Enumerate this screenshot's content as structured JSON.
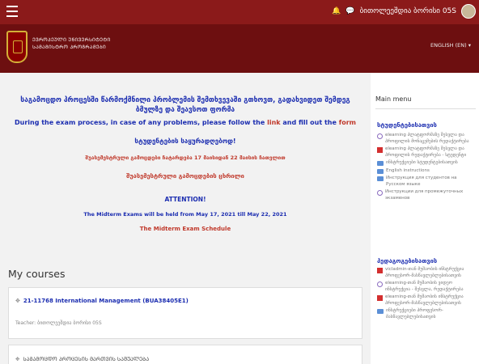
{
  "topbar": {
    "user_name": "ბითოლეეშდია ბორისი 05S",
    "bell_icon": "bell-icon",
    "chat_icon": "message-icon"
  },
  "header": {
    "university_line1": "ᲔᲕᲠᲝᲞᲔᲣᲚᲘ ᲣᲜᲘᲕᲔᲠᲡᲘᲢᲔᲢᲘ",
    "university_line2": "ᲡᲐᲛᲐᲒᲘᲡᲢᲠᲝ ᲞᲠᲝᲒᲠᲐᲛᲔᲑᲘ",
    "language": "ENGLISH (EN) ▾"
  },
  "announcement": {
    "georgian_intro": "საგამოცდო პროცესში წარმოქმნილი პრობლემის შემთხვევაში გთხოვთ, გადახვიდეთ შემდეგ ბმულზე და შეავსოთ ფორმა",
    "english_intro_prefix": "During the exam process, in case of any problems, please follow the",
    "link_text": "link",
    "english_intro_mid": "and fill out the",
    "form_text": "form",
    "students_attention": "სტუდენტების საყურადღებოდ!",
    "midterm_georgian": "შუასემესტრული გამოცდები ჩატარდება 17 მაისიდან 22 მაისის ჩათვლით",
    "midterm_schedule_georgian": "შუასემესტრული გამოცდების ცხრილი",
    "attention": "ATTENTION!",
    "midterm_english_prefix": "The Midterm Exams will be held from May 17, 2021 till",
    "midterm_english_date": "May 22, 2021",
    "midterm_schedule_english": "The Midterm Exam Schedule"
  },
  "courses": {
    "heading": "My courses",
    "items": [
      {
        "title": "21-11768 International Management (BUA38405E1)",
        "teacher": "Teacher: ბითოლეეშდია ბორისი 05S"
      },
      {
        "title": "ᲡᲐᲒᲐᲛᲝᲪᲓᲝ ᲞᲠᲝᲪᲔᲡᲘᲡ ᲛᲐᲠᲗᲕᲘᲡ ᲡᲐᲨᲣᲐᲚᲔᲑᲐ",
        "teacher": ""
      }
    ]
  },
  "sidebar": {
    "main_menu": "Main menu",
    "students_heading": "სტუდენტებისათვის",
    "students_items": [
      {
        "icon": "quiz",
        "text": "elearning პლატფორმაზე შესვლა და პროფილის მონაცემების რედაქტირება"
      },
      {
        "icon": "pdf",
        "text": "elearning პლატფორმაზე შესვლა და პროფილის რედაქტირება - სტუდენტი"
      },
      {
        "icon": "folder",
        "text": "ინსტრუქციები სტუდენტებისათვის"
      },
      {
        "icon": "folder",
        "text": "English instructions"
      },
      {
        "icon": "folder",
        "text": "Инструкция для студентов на Русском языке"
      },
      {
        "icon": "quiz",
        "text": "Инструкции для промежуточных экзаменов"
      }
    ],
    "teachers_heading": "პედაგოგებისათვის",
    "teachers_items": [
      {
        "icon": "pdf",
        "text": "vicladmin-თან მუშაობის ინსტრუქცია პროფესორ-მასწავლებლებისათვის"
      },
      {
        "icon": "quiz",
        "text": "elearning-თან მუშაობის ვიდეო ინსტრუქცია - შესვლა, რედაქტირება"
      },
      {
        "icon": "pdf",
        "text": "elearning-თან მუშაობის ინსტრუქცია პროფესორ-მასწავლებლებისათვის"
      },
      {
        "icon": "folder",
        "text": "ინსტრუქციები პროფესორ-მასწავლებლებისათვის"
      }
    ]
  }
}
